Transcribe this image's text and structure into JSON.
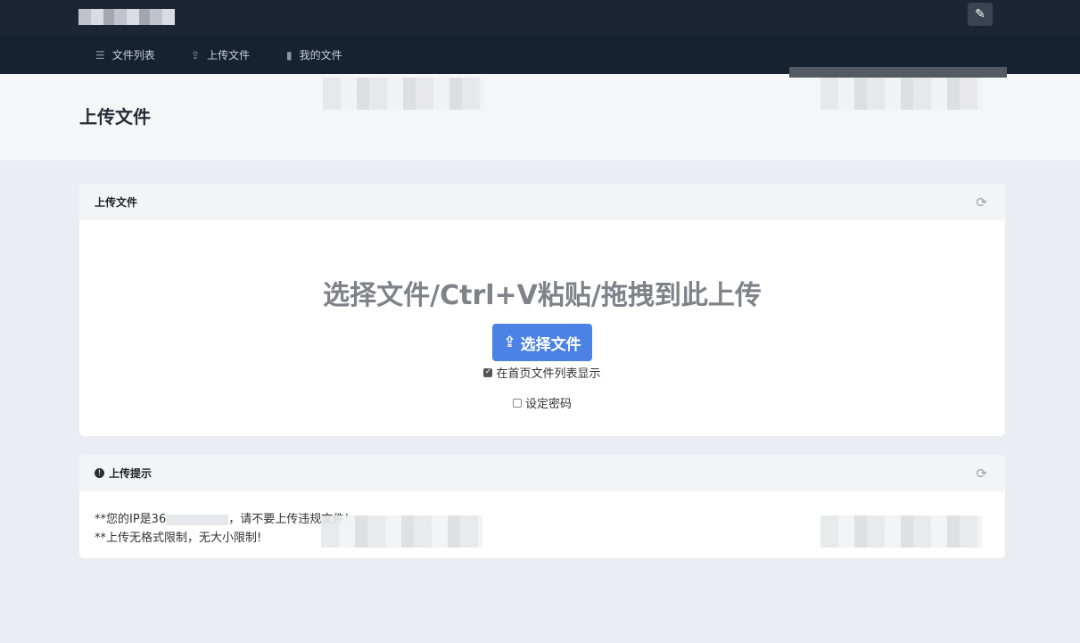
{
  "theme_icon": "brush-icon",
  "nav": [
    {
      "icon": "list-icon",
      "glyph": "☰",
      "label": "文件列表"
    },
    {
      "icon": "upload-icon",
      "glyph": "⇪",
      "label": "上传文件"
    },
    {
      "icon": "file-icon",
      "glyph": "▮",
      "label": "我的文件"
    }
  ],
  "page_title": "上传文件",
  "upload_card": {
    "title": "上传文件",
    "drop_text": "选择文件/Ctrl+V粘贴/拖拽到此上传",
    "button_label": "选择文件",
    "option_show_on_home": {
      "label": "在首页文件列表显示",
      "checked": true
    },
    "option_set_password": {
      "label": "设定密码",
      "checked": false
    }
  },
  "tips_card": {
    "title": "上传提示",
    "line1_prefix": "**您的IP是36",
    "line1_suffix": "，请不要上传违规文件!",
    "line2": "**上传无格式限制，无大小限制!"
  },
  "colors": {
    "topbar": "#1c2536",
    "navbar": "#162131",
    "primary_button": "#4b82e3"
  }
}
